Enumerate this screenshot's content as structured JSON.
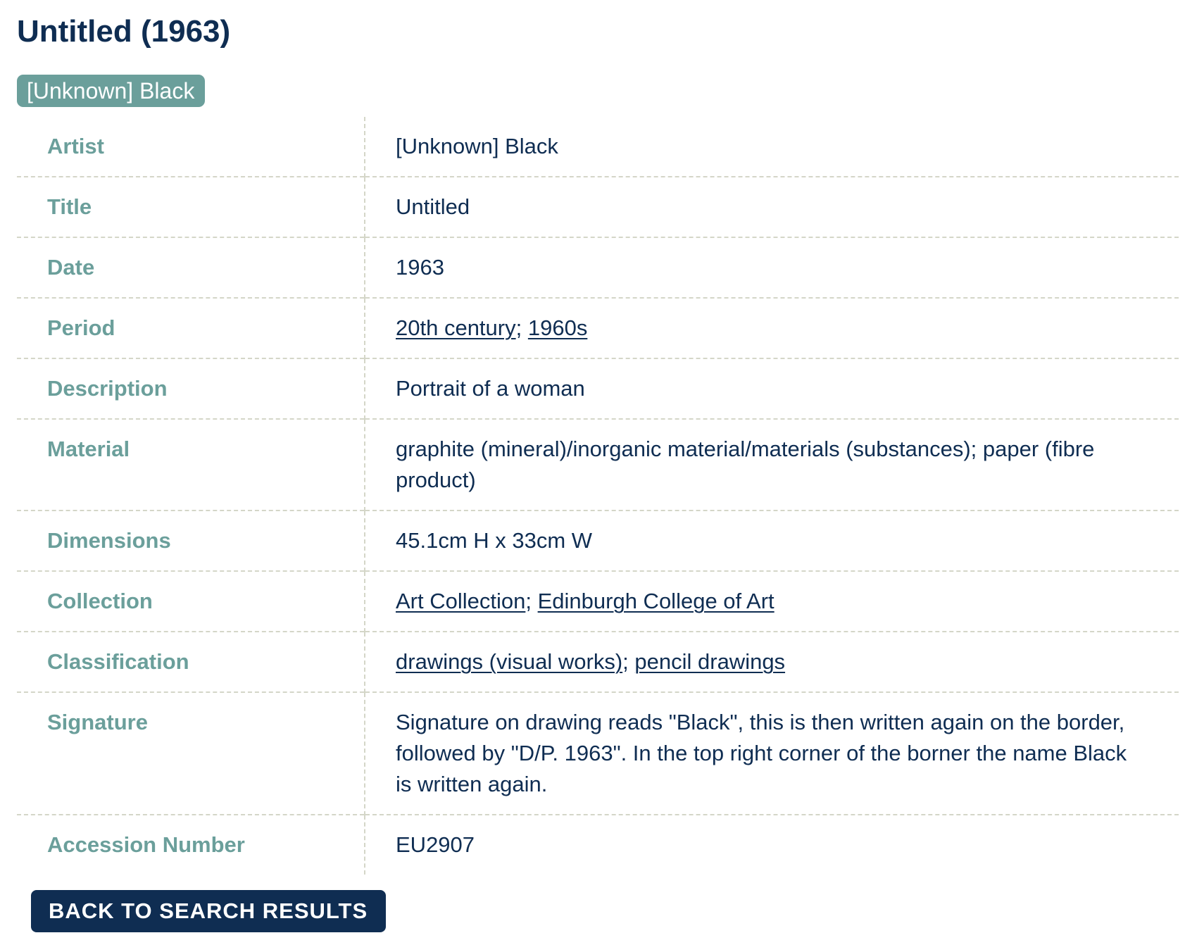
{
  "page": {
    "title": "Untitled (1963)",
    "artist_badge": "[Unknown] Black"
  },
  "details": {
    "artist": {
      "label": "Artist",
      "value": "[Unknown] Black"
    },
    "title": {
      "label": "Title",
      "value": "Untitled"
    },
    "date": {
      "label": "Date",
      "value": "1963"
    },
    "period": {
      "label": "Period",
      "links": [
        "20th century",
        "1960s"
      ],
      "separator": ";"
    },
    "description": {
      "label": "Description",
      "value": "Portrait of a woman"
    },
    "material": {
      "label": "Material",
      "value": "graphite (mineral)/inorganic material/materials (substances); paper (fibre product)"
    },
    "dimensions": {
      "label": "Dimensions",
      "value": "45.1cm H x 33cm W"
    },
    "collection": {
      "label": "Collection",
      "links": [
        "Art Collection",
        "Edinburgh College of Art"
      ],
      "separator": ";"
    },
    "classification": {
      "label": "Classification",
      "links": [
        "drawings (visual works)",
        "pencil drawings"
      ],
      "separator": ";"
    },
    "signature": {
      "label": "Signature",
      "value": "Signature on drawing reads \"Black\", this is then written again on the border, followed by \"D/P. 1963\". In the top right corner of the borner the name Black is written again."
    },
    "accession_number": {
      "label": "Accession Number",
      "value": "EU2907"
    }
  },
  "actions": {
    "back_label": "BACK TO SEARCH RESULTS"
  },
  "colors": {
    "primary": "#0f2d52",
    "accent": "#6b9f9b",
    "divider": "#d4d6c8"
  }
}
